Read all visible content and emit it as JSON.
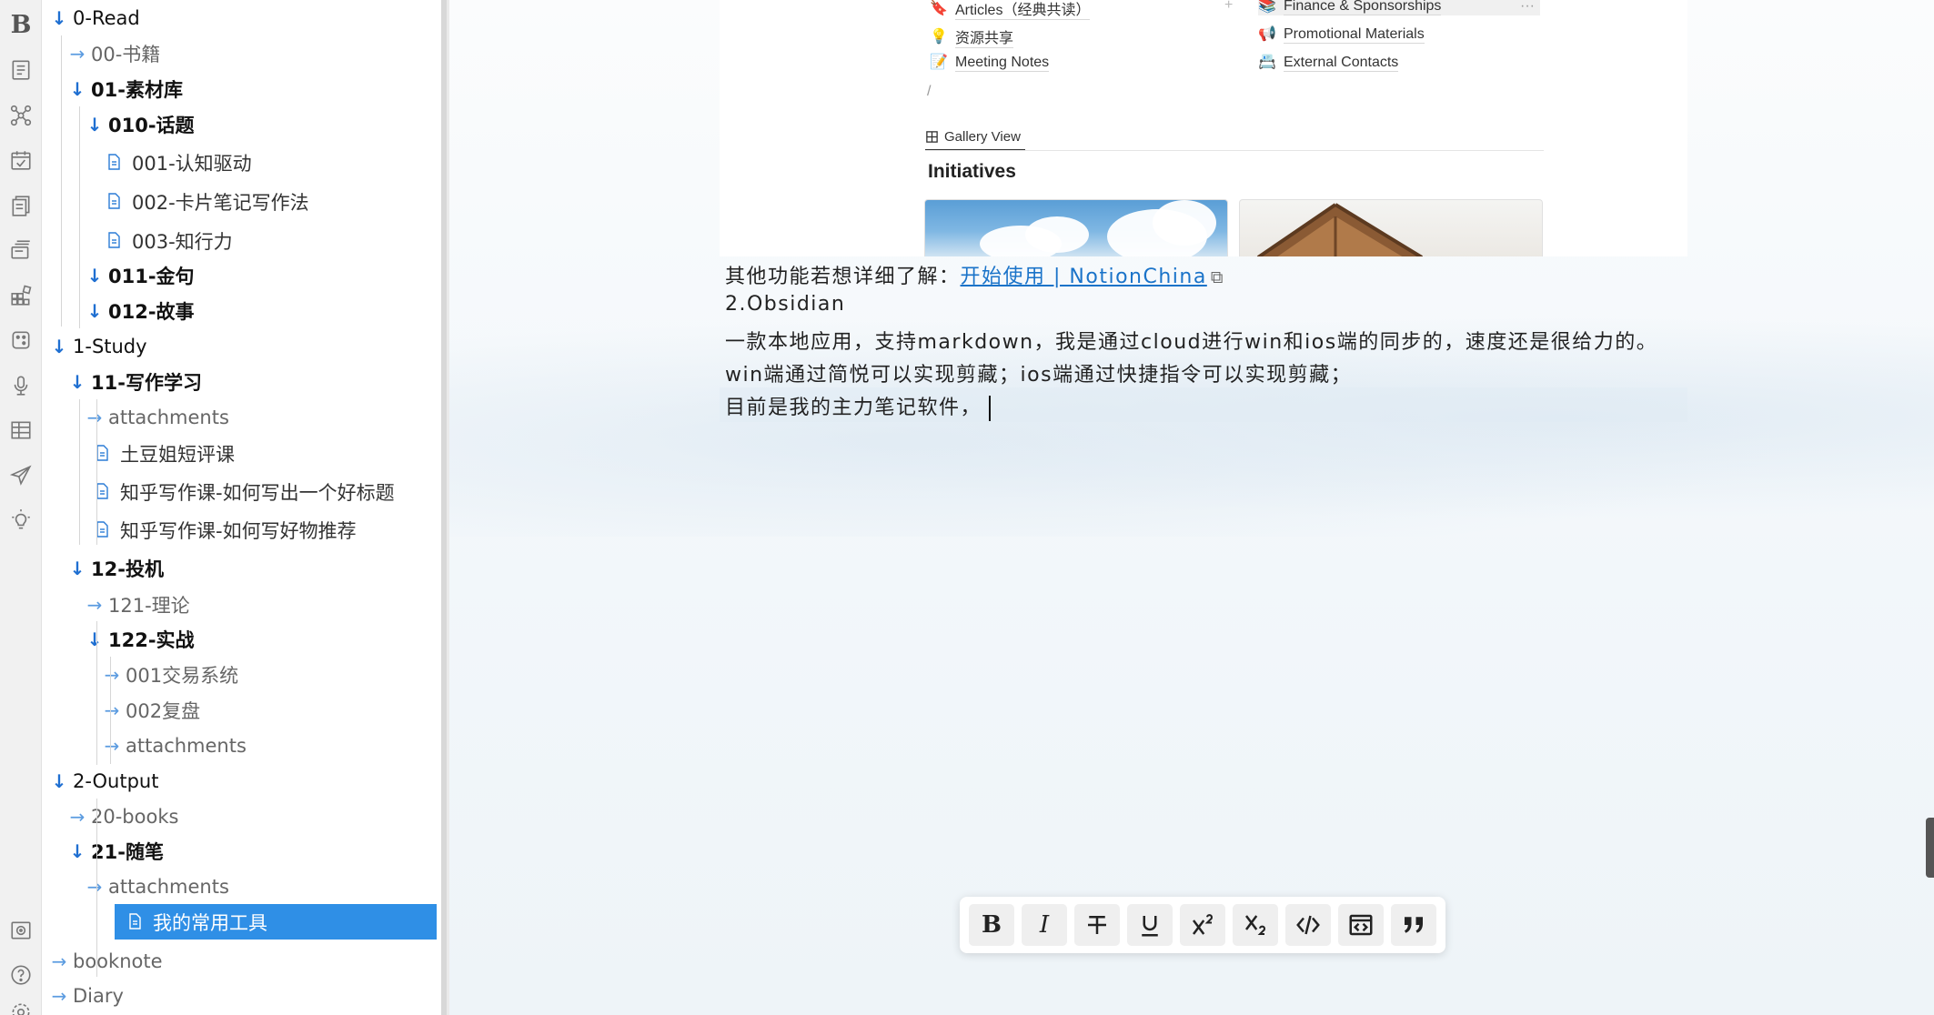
{
  "rail": {
    "logo": "B",
    "icons": [
      "outline-icon",
      "graph-icon",
      "calendar-icon",
      "notes-icon",
      "cards-icon",
      "plugins-icon",
      "dice-icon",
      "microphone-icon",
      "table-icon",
      "send-icon",
      "lightbulb-icon",
      "vault-icon",
      "help-icon",
      "settings-icon"
    ]
  },
  "tree": {
    "items": [
      {
        "label": "0-Read",
        "kind": "open-top"
      },
      {
        "label": "00-书籍",
        "kind": "closed"
      },
      {
        "label": "01-素材库",
        "kind": "open"
      },
      {
        "label": "010-话题",
        "kind": "open"
      },
      {
        "label": "001-认知驱动",
        "kind": "file"
      },
      {
        "label": "002-卡片笔记写作法",
        "kind": "file"
      },
      {
        "label": "003-知行力",
        "kind": "file"
      },
      {
        "label": "011-金句",
        "kind": "open"
      },
      {
        "label": "012-故事",
        "kind": "open"
      },
      {
        "label": "1-Study",
        "kind": "open-top"
      },
      {
        "label": "11-写作学习",
        "kind": "open"
      },
      {
        "label": "attachments",
        "kind": "closed"
      },
      {
        "label": "土豆姐短评课",
        "kind": "file"
      },
      {
        "label": "知乎写作课-如何写出一个好标题",
        "kind": "file"
      },
      {
        "label": "知乎写作课-如何写好物推荐",
        "kind": "file"
      },
      {
        "label": "12-投机",
        "kind": "open"
      },
      {
        "label": "121-理论",
        "kind": "closed"
      },
      {
        "label": "122-实战",
        "kind": "open"
      },
      {
        "label": "001交易系统",
        "kind": "closed"
      },
      {
        "label": "002复盘",
        "kind": "closed"
      },
      {
        "label": "attachments",
        "kind": "closed"
      },
      {
        "label": "2-Output",
        "kind": "open-top"
      },
      {
        "label": "20-books",
        "kind": "closed"
      },
      {
        "label": "21-随笔",
        "kind": "open"
      },
      {
        "label": "attachments",
        "kind": "closed"
      },
      {
        "label": "我的常用工具",
        "kind": "file",
        "selected": true
      },
      {
        "label": "booknote",
        "kind": "closed"
      },
      {
        "label": "Diary",
        "kind": "closed"
      }
    ]
  },
  "embed": {
    "items": [
      {
        "label": "Articles（经典共读）",
        "icon": "bookmark-icon"
      },
      {
        "label": "资源共享",
        "icon": "bulb-icon"
      },
      {
        "label": "Meeting Notes",
        "icon": "memo-icon"
      },
      {
        "label": "Finance & Sponsorships",
        "icon": "books-icon"
      },
      {
        "label": "Promotional Materials",
        "icon": "megaphone-icon"
      },
      {
        "label": "External Contacts",
        "icon": "card-index-icon"
      }
    ],
    "slash": "/",
    "tab": "Gallery View",
    "heading": "Initiatives"
  },
  "doc": {
    "line1_prefix": "其他功能若想详细了解：",
    "line1_link": "开始使用 | NotionChina",
    "line2": "2.Obsidian",
    "line3": "一款本地应用，支持markdown，我是通过cloud进行win和ios端的同步的，速度还是很给力的。",
    "line4": "win端通过简悦可以实现剪藏；ios端通过快捷指令可以实现剪藏；",
    "line5": "目前是我的主力笔记软件，"
  },
  "toolbar": {
    "buttons": [
      "bold-icon",
      "italic-icon",
      "strikethrough-icon",
      "underline-icon",
      "superscript-icon",
      "subscript-icon",
      "inline-code-icon",
      "code-block-icon",
      "quote-icon"
    ]
  },
  "colors": {
    "accent": "#2f8fe6",
    "link": "#1a73c9",
    "folder_arrow": "#1f6fd1"
  }
}
